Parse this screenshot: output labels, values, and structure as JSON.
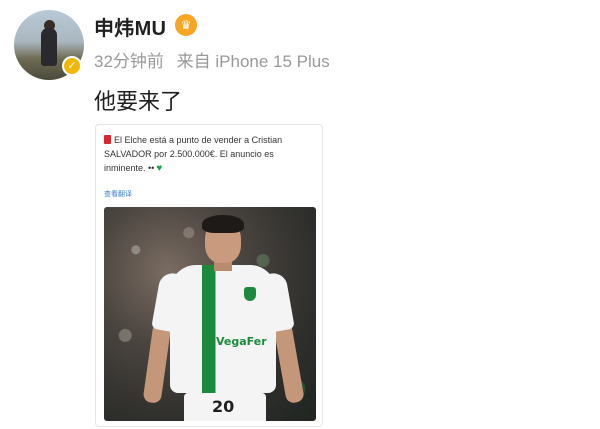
{
  "user": {
    "name": "申炜MU",
    "verified_icon": "check",
    "vip_icon": "crown"
  },
  "meta": {
    "time": "32分钟前",
    "source": "来自 iPhone 15 Plus"
  },
  "post": {
    "text": "他要来了"
  },
  "card": {
    "text": "El Elche está a punto de vender a Cristian SALVADOR por 2.500.000€. El anuncio es inminente. ••",
    "link": "查看翻译",
    "player_number": "20",
    "sponsor": "VegaFer"
  },
  "colors": {
    "username": "#1f1f1f",
    "meta": "#9a9a9a",
    "link": "#3b7fd1",
    "elche_green": "#1c8a3c",
    "badge": "#f2b705"
  }
}
